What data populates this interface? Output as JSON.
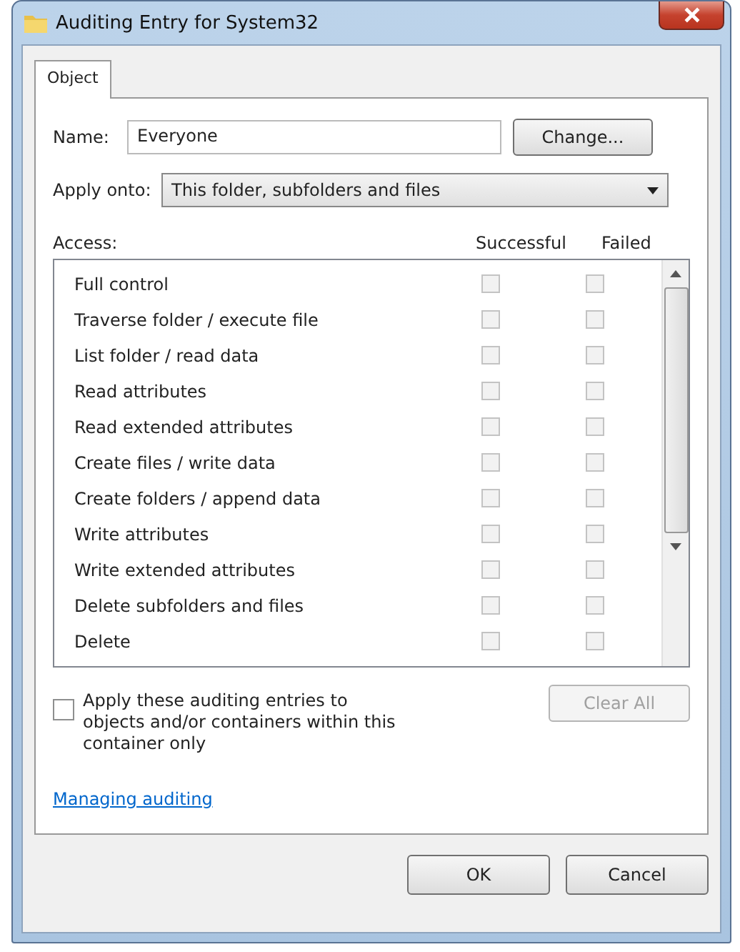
{
  "window": {
    "title": "Auditing Entry for System32"
  },
  "tabs": [
    {
      "label": "Object",
      "selected": true
    }
  ],
  "name": {
    "label": "Name:",
    "value": "Everyone",
    "button": "Change..."
  },
  "apply_onto": {
    "label": "Apply onto:",
    "value": "This folder, subfolders and files"
  },
  "access": {
    "label": "Access:",
    "columns": [
      "Successful",
      "Failed"
    ],
    "checks_disabled": true,
    "rows": [
      {
        "name": "Full control",
        "successful": false,
        "failed": false
      },
      {
        "name": "Traverse folder / execute file",
        "successful": false,
        "failed": false
      },
      {
        "name": "List folder / read data",
        "successful": false,
        "failed": false
      },
      {
        "name": "Read attributes",
        "successful": false,
        "failed": false
      },
      {
        "name": "Read extended attributes",
        "successful": false,
        "failed": false
      },
      {
        "name": "Create files / write data",
        "successful": false,
        "failed": false
      },
      {
        "name": "Create folders / append data",
        "successful": false,
        "failed": false
      },
      {
        "name": "Write attributes",
        "successful": false,
        "failed": false
      },
      {
        "name": "Write extended attributes",
        "successful": false,
        "failed": false
      },
      {
        "name": "Delete subfolders and files",
        "successful": false,
        "failed": false
      },
      {
        "name": "Delete",
        "successful": false,
        "failed": false
      }
    ]
  },
  "apply_only": {
    "label": "Apply these auditing entries to objects and/or containers within this container only",
    "checked": false
  },
  "clear_all": {
    "label": "Clear All",
    "disabled": true
  },
  "link": "Managing auditing",
  "buttons": [
    "OK",
    "Cancel"
  ]
}
